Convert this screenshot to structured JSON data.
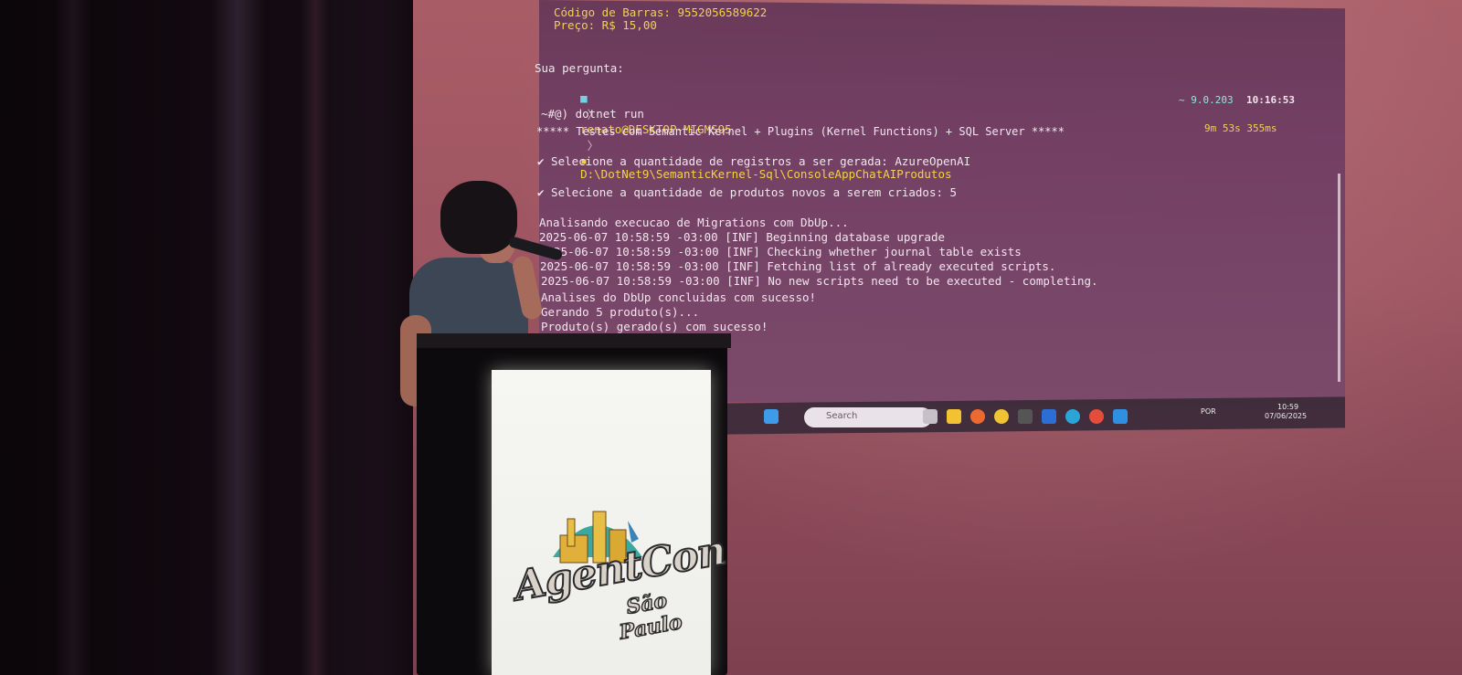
{
  "terminal": {
    "lines": [
      {
        "text": "Código de Barras: 9552056589622"
      },
      {
        "text": "Preço: R$ 15,00"
      },
      {
        "text": "Sua pergunta:"
      },
      {
        "text": "renato@DESKTOP-MIGMS95"
      },
      {
        "text": "D:\\DotNet9\\SemanticKernel-Sql\\ConsoleAppChatAIProdutos"
      },
      {
        "text": "~ 9.0.203"
      },
      {
        "text": "10:16:53"
      },
      {
        "text": "~#@) dotnet run"
      },
      {
        "text": "***** Testes com Semantic Kernel + Plugins (Kernel Functions) + SQL Server *****"
      },
      {
        "text": "9m 53s 355ms"
      },
      {
        "text": "✔ Selecione a quantidade de registros a ser gerada: AzureOpenAI"
      },
      {
        "text": "✔ Selecione a quantidade de produtos novos a serem criados: 5"
      },
      {
        "text": "Analisando execucao de Migrations com DbUp..."
      },
      {
        "text": "2025-06-07 10:58:59 -03:00 [INF] Beginning database upgrade"
      },
      {
        "text": "2025-06-07 10:58:59 -03:00 [INF] Checking whether journal table exists"
      },
      {
        "text": "2025-06-07 10:58:59 -03:00 [INF] Fetching list of already executed scripts."
      },
      {
        "text": "2025-06-07 10:58:59 -03:00 [INF] No new scripts need to be executed - completing."
      },
      {
        "text": "Analises do DbUp concluidas com sucesso!"
      },
      {
        "text": "Gerando 5 produto(s)..."
      },
      {
        "text": "Produto(s) gerado(s) com sucesso!"
      }
    ]
  },
  "taskbar": {
    "search_placeholder": "Search",
    "tray_lang": "POR",
    "tray_time": "10:59",
    "tray_date": "07/06/2025"
  },
  "podium": {
    "logo_main": "AgentCon",
    "logo_sub": "São Paulo"
  },
  "colors": {
    "screen": "#a85c66",
    "terminal_bg": "#6a3a59",
    "prompt_yellow": "#f0d24a",
    "check_green": "#72e08b"
  }
}
